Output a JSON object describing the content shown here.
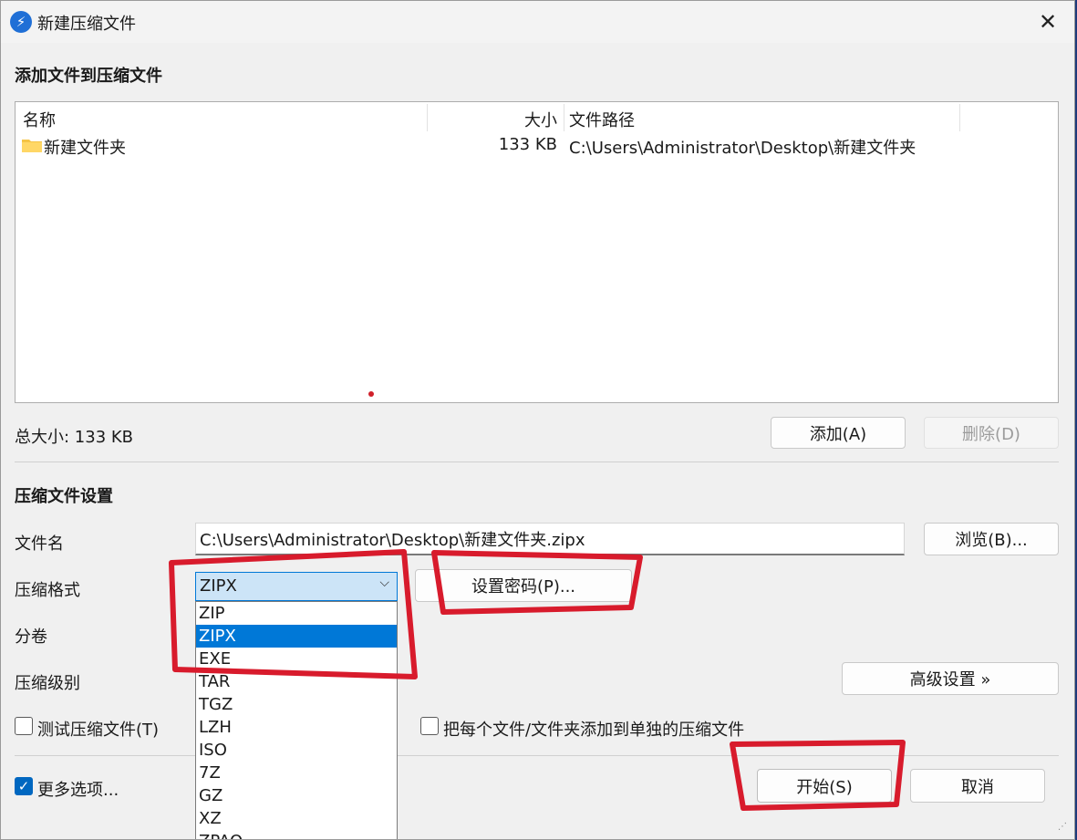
{
  "window": {
    "title": "新建压缩文件"
  },
  "add_section": {
    "title": "添加文件到压缩文件",
    "columns": [
      "名称",
      "大小",
      "文件路径"
    ],
    "rows": [
      {
        "name": "新建文件夹",
        "size": "133 KB",
        "path": "C:\\Users\\Administrator\\Desktop\\新建文件夹"
      }
    ],
    "total_size": "总大小: 133 KB",
    "add_button": "添加(A)",
    "delete_button": "删除(D)"
  },
  "settings": {
    "title": "压缩文件设置",
    "filename_label": "文件名",
    "filename_value": "C:\\Users\\Administrator\\Desktop\\新建文件夹.zipx",
    "browse_button": "浏览(B)...",
    "format_label": "压缩格式",
    "format_selected": "ZIPX",
    "format_options": [
      "ZIP",
      "ZIPX",
      "EXE",
      "TAR",
      "TGZ",
      "LZH",
      "ISO",
      "7Z",
      "GZ",
      "XZ",
      "ZPAQ"
    ],
    "password_button": "设置密码(P)...",
    "split_label": "分卷",
    "level_label": "压缩级别",
    "advanced_button": "高级设置 »",
    "test_checkbox": "测试压缩文件(T)",
    "separate_checkbox": "把每个文件/文件夹添加到单独的压缩文件"
  },
  "footer": {
    "more_options": "更多选项...",
    "start_button": "开始(S)",
    "cancel_button": "取消"
  },
  "colors": {
    "accent": "#0078d7",
    "annotation": "#d81b2c"
  }
}
